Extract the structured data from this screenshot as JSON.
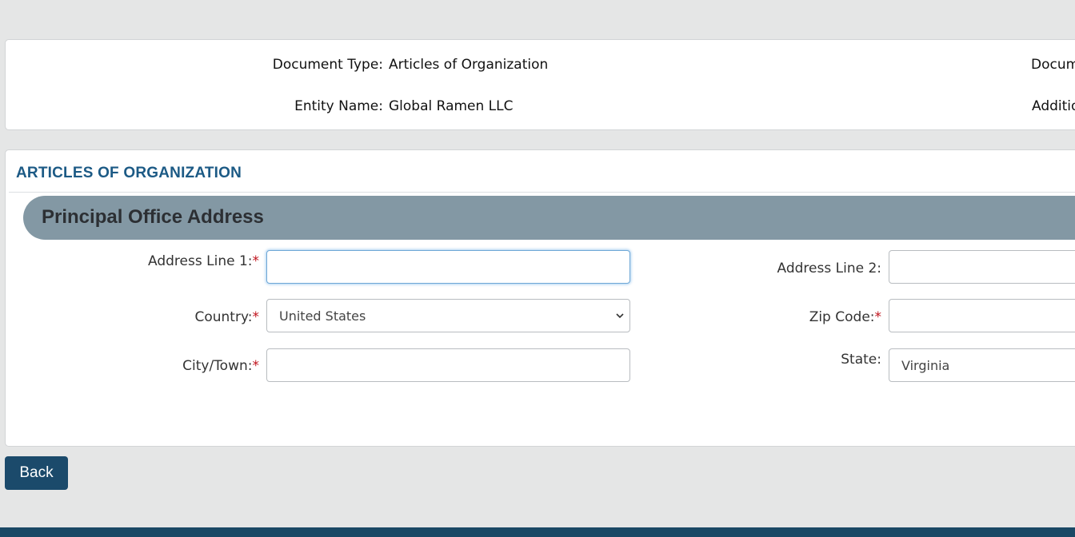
{
  "summary": {
    "document_type_label": "Document Type:",
    "document_type_value": "Articles of Organization",
    "entity_name_label": "Entity Name:",
    "entity_name_value": "Global Ramen LLC",
    "right_label_1": "Docum",
    "right_label_2": "Additio"
  },
  "form": {
    "section_title": "ARTICLES OF ORGANIZATION",
    "band_title": "Principal Office Address",
    "required_marker": "*",
    "fields": {
      "address_line_1": {
        "label": "Address Line 1:",
        "value": ""
      },
      "address_line_2": {
        "label": "Address Line 2:",
        "value": ""
      },
      "country": {
        "label": "Country:",
        "value": "United States"
      },
      "zip_code": {
        "label": "Zip Code:",
        "value": ""
      },
      "city": {
        "label": "City/Town:",
        "value": ""
      },
      "state": {
        "label": "State:",
        "value": "Virginia"
      }
    }
  },
  "actions": {
    "back_label": "Back"
  },
  "colors": {
    "page_bg": "#e5e6e6",
    "section_title": "#1c5a85",
    "band": "#8398a4",
    "button": "#1b4a6b",
    "required": "#c0121c",
    "footer": "#1a4865"
  },
  "icons": {
    "select_arrow": "chevron-down-icon"
  }
}
